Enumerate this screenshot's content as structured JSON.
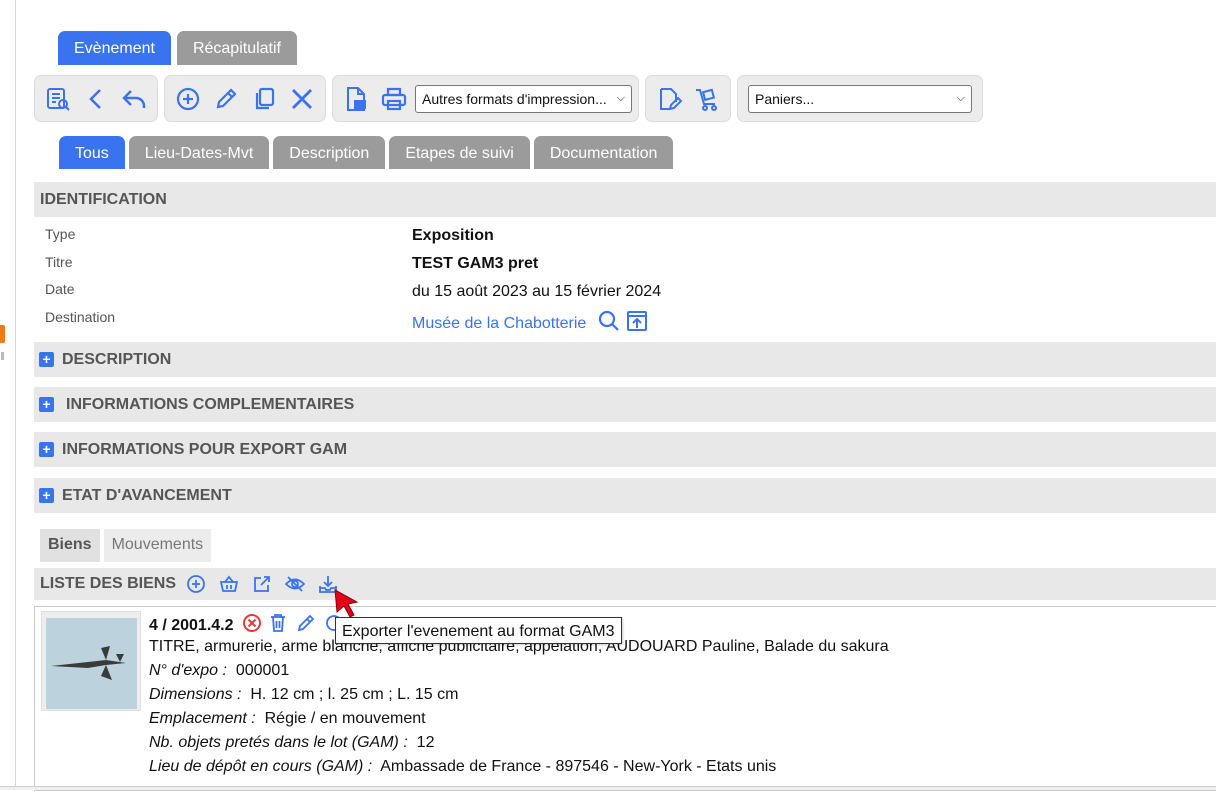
{
  "main_tabs": [
    {
      "label": "Evènement",
      "active": true
    },
    {
      "label": "Récapitulatif",
      "active": false
    }
  ],
  "toolbar": {
    "print_select": "Autres formats d'impression...",
    "basket_select": "Paniers...",
    "icons": [
      "list-search-icon",
      "back-icon",
      "undo-icon",
      "add-icon",
      "edit-icon",
      "copy-icon",
      "delete-icon",
      "pdf-icon",
      "print-icon",
      "clipboard-edit-icon",
      "cart-icon"
    ]
  },
  "sub_tabs": [
    {
      "label": "Tous",
      "active": true
    },
    {
      "label": "Lieu-Dates-Mvt",
      "active": false
    },
    {
      "label": "Description",
      "active": false
    },
    {
      "label": "Etapes de suivi",
      "active": false
    },
    {
      "label": "Documentation",
      "active": false
    }
  ],
  "identification": {
    "title": "IDENTIFICATION",
    "fields": [
      {
        "label": "Type",
        "value": "Exposition"
      },
      {
        "label": "Titre",
        "value": "TEST GAM3 pret"
      },
      {
        "label": "Date",
        "value": "du 15 août 2023 au 15 février 2024"
      },
      {
        "label": "Destination",
        "value": "Musée de la Chabotterie"
      }
    ]
  },
  "sections": [
    "DESCRIPTION",
    "INFORMATIONS COMPLEMENTAIRES",
    "INFORMATIONS POUR EXPORT GAM",
    "ETAT D'AVANCEMENT"
  ],
  "list_tabs": [
    {
      "label": "Biens",
      "active": true
    },
    {
      "label": "Mouvements",
      "active": false
    }
  ],
  "list": {
    "title": "LISTE DES BIENS",
    "tooltip": "Exporter l'evenement au format GAM3",
    "item": {
      "number": "4 / 2001.4.2",
      "description": "TITRE, armurerie, arme blanche, affiche publicitaire, appelation, AUDOUARD Pauline, Balade du sakura",
      "rows": [
        {
          "label": "N° d'expo :",
          "value": "000001"
        },
        {
          "label": "Dimensions :",
          "value": "H. 12 cm ; l. 25 cm ; L. 15 cm"
        },
        {
          "label": "Emplacement :",
          "value": "Régie / en mouvement"
        },
        {
          "label": "Nb. objets pretés dans le lot (GAM) :",
          "value": "12"
        },
        {
          "label": "Lieu de dépôt en cours (GAM) :",
          "value": "Ambassade de France - 897546 - New-York - Etats unis"
        }
      ]
    }
  },
  "colors": {
    "accent": "#3a73f0",
    "danger": "#e53935",
    "tab_inactive": "#9b9b9b"
  }
}
